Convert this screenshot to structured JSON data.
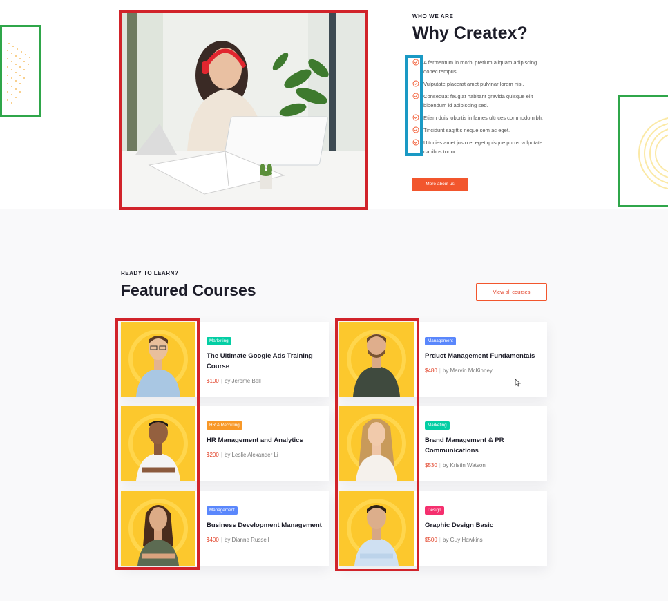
{
  "about": {
    "eyebrow": "WHO WE ARE",
    "title": "Why Createx?",
    "checks": [
      "A fermentum in morbi pretium aliquam adipiscing donec tempus.",
      "Vulputate placerat amet pulvinar lorem nisi.",
      "Consequat feugiat habitant gravida quisque elit bibendum id adipiscing sed.",
      "Etiam duis lobortis in fames ultrices commodo nibh.",
      "Tincidunt sagittis neque sem ac eget.",
      "Ultricies amet justo et eget quisque purus vulputate dapibus tortor."
    ],
    "cta_label": "More about us",
    "check_icon": "check-circle-icon",
    "accent_color": "#f2562d"
  },
  "courses": {
    "eyebrow": "READY TO LEARN?",
    "title": "Featured Courses",
    "view_all_label": "View all courses",
    "items": [
      {
        "category": "Marketing",
        "category_color": "#03cea4",
        "title": "The Ultimate Google Ads Training Course",
        "price": "$100",
        "author": "by Jerome Bell"
      },
      {
        "category": "Management",
        "category_color": "#5a87fc",
        "title": "Prduct Management Fundamentals",
        "price": "$480",
        "author": "by Marvin McKinney"
      },
      {
        "category": "HR & Recruting",
        "category_color": "#f89828",
        "title": "HR  Management and Analytics",
        "price": "$200",
        "author": "by Leslie Alexander Li"
      },
      {
        "category": "Marketing",
        "category_color": "#03cea4",
        "title": "Brand Management & PR Communications",
        "price": "$530",
        "author": "by Kristin Watson"
      },
      {
        "category": "Management",
        "category_color": "#5a87fc",
        "title": "Business Development Management",
        "price": "$400",
        "author": "by Dianne Russell"
      },
      {
        "category": "Design",
        "category_color": "#f52f6e",
        "title": "Graphic Design Basic",
        "price": "$500",
        "author": "by Guy Hawkins"
      }
    ]
  },
  "colors": {
    "brand_orange": "#f2562d",
    "price_red": "#e2452c",
    "card_yellow": "#fcc82d"
  }
}
